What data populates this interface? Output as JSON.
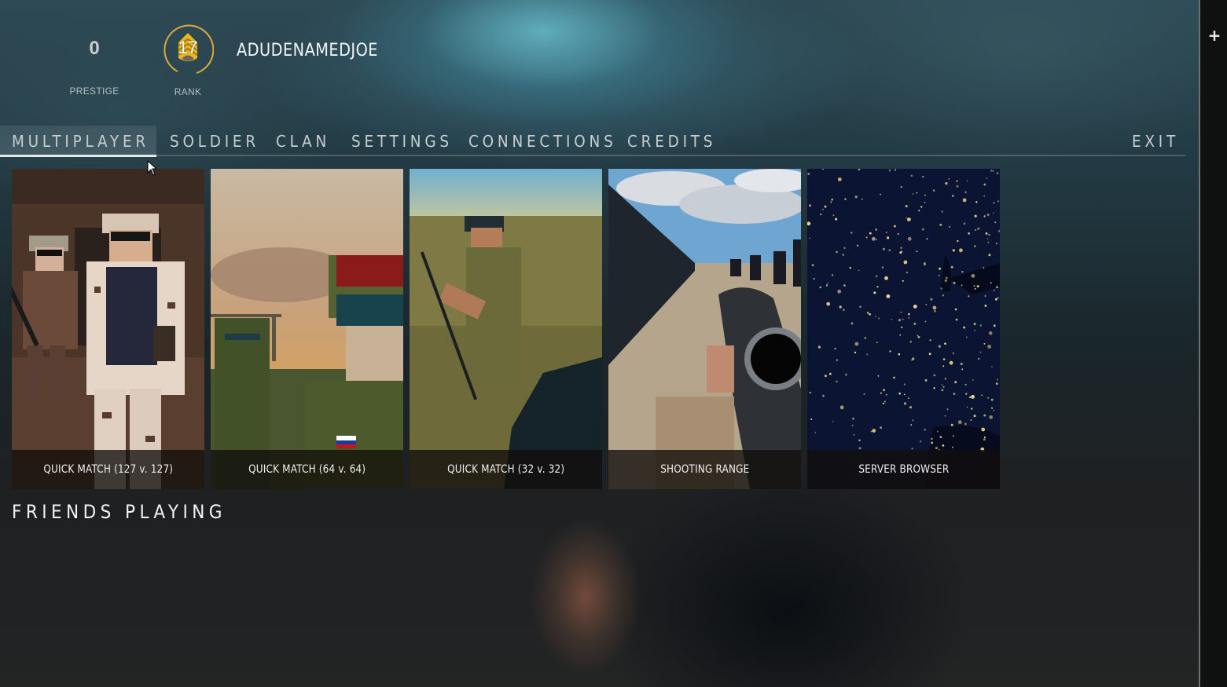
{
  "profile": {
    "prestige_value": "0",
    "prestige_label": "PRESTIGE",
    "rank_value": "17",
    "rank_label": "RANK",
    "username": "ADUDENAMEDJOE",
    "rank_badge_icon": "sergeant-chevron-icon",
    "rank_ring_color": "#e0a83a",
    "rank_badge_color": "#e8b820"
  },
  "nav": {
    "items": [
      {
        "label": "MULTIPLAYER",
        "active": true
      },
      {
        "label": "SOLDIER",
        "active": false
      },
      {
        "label": "CLAN",
        "active": false
      },
      {
        "label": "SETTINGS",
        "active": false
      },
      {
        "label": "CONNECTIONS",
        "active": false
      },
      {
        "label": "CREDITS",
        "active": false
      }
    ],
    "exit_label": "EXIT"
  },
  "modes": [
    {
      "label": "QUICK MATCH (127 v. 127)",
      "image": "soldiers-desert-camo"
    },
    {
      "label": "QUICK MATCH (64 v. 64)",
      "image": "soldiers-sunset-green-camo"
    },
    {
      "label": "QUICK MATCH (32 v. 32)",
      "image": "sniper-grass-field"
    },
    {
      "label": "SHOOTING RANGE",
      "image": "range-targets-scoped-rifle"
    },
    {
      "label": "SERVER BROWSER",
      "image": "night-lights-map"
    }
  ],
  "friends": {
    "title": "FRIENDS PLAYING"
  },
  "sidebar": {
    "add_icon": "plus-icon"
  }
}
